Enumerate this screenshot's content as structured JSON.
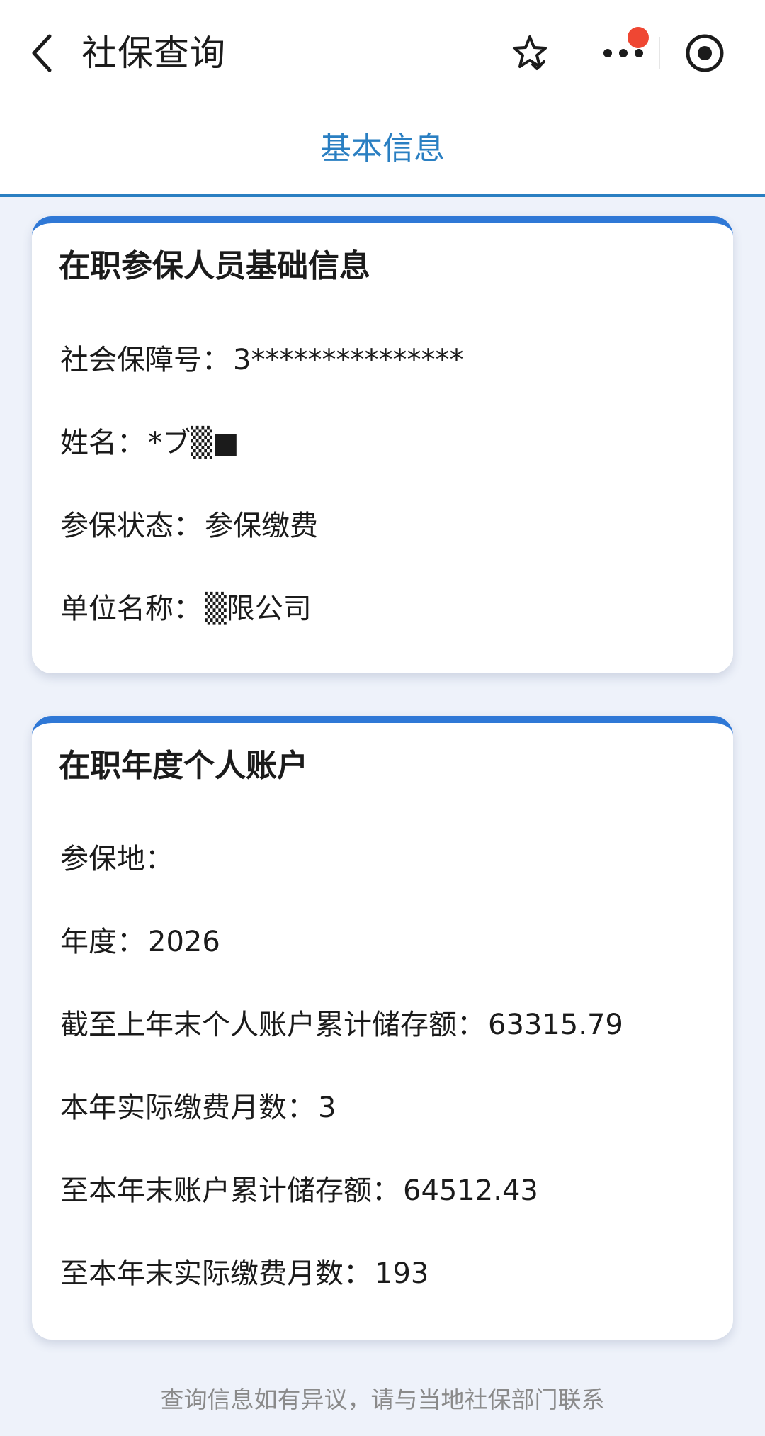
{
  "header": {
    "title": "社保查询",
    "icons": {
      "back": "chevron-left-icon",
      "favorite": "star-icon",
      "more": "more-dots-icon",
      "record": "record-target-icon"
    },
    "notification_dot_color": "#ef4733"
  },
  "tabs": {
    "active": "基本信息"
  },
  "colors": {
    "accent": "#2a7fc2",
    "card_top_border": "#2f78d6",
    "background": "#eef2fa"
  },
  "basic_info": {
    "title": "在职参保人员基础信息",
    "fields": [
      {
        "label": "社会保障号：",
        "value": "3***************"
      },
      {
        "label": "姓名：",
        "value": "*ブ▒■"
      },
      {
        "label": "参保状态：",
        "value": "参保缴费"
      },
      {
        "label": "单位名称：",
        "value": "▒限公司"
      }
    ]
  },
  "annual_account": {
    "title": "在职年度个人账户",
    "fields": [
      {
        "label": "参保地：",
        "value": ""
      },
      {
        "label": "年度：",
        "value": "2026"
      },
      {
        "label": "截至上年末个人账户累计储存额：",
        "value": "63315.79"
      },
      {
        "label": "本年实际缴费月数：",
        "value": "3"
      },
      {
        "label": "至本年末账户累计储存额：",
        "value": "64512.43"
      },
      {
        "label": "至本年末实际缴费月数：",
        "value": "193"
      }
    ]
  },
  "footer": {
    "note": "查询信息如有异议，请与当地社保部门联系"
  }
}
